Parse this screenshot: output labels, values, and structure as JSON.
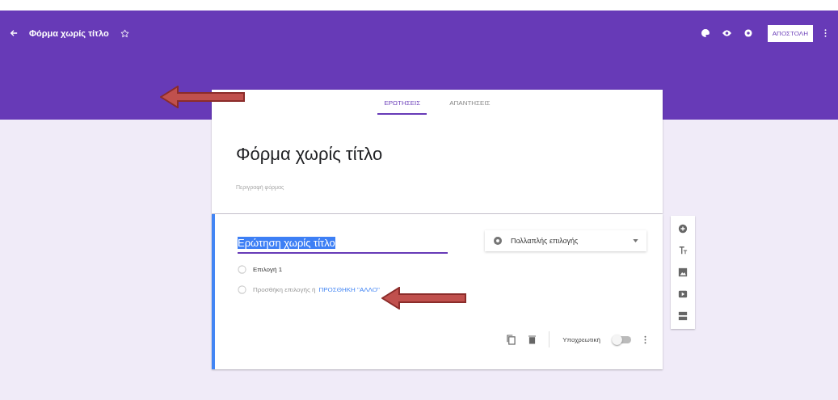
{
  "header": {
    "title": "Φόρμα χωρίς τίτλο",
    "send_label": "ΑΠΟΣΤΟΛΗ"
  },
  "tabs": [
    {
      "label": "ΕΡΩΤΗΣΕΙΣ",
      "selected": true
    },
    {
      "label": "ΑΠΑΝΤΗΣΕΙΣ",
      "selected": false
    }
  ],
  "form": {
    "title": "Φόρμα χωρίς τίτλο",
    "description_placeholder": "Περιγραφή φόρμας"
  },
  "question": {
    "title": "Ερώτηση χωρίς τίτλο",
    "title_highlighted": true,
    "type": "Πολλαπλής επιλογής",
    "options": [
      {
        "kind": "option",
        "label": "Επιλογή 1"
      },
      {
        "kind": "add",
        "label": "Προσθήκη επιλογής ή",
        "link": "ΠΡΟΣΘΗΚΗ \"ΑΛΛΟ\""
      }
    ],
    "required_label": "Υποχρεωτική",
    "required": false
  },
  "side_tools": [
    {
      "kind": "add"
    },
    {
      "kind": "title"
    },
    {
      "kind": "image"
    },
    {
      "kind": "video"
    },
    {
      "kind": "section"
    }
  ],
  "annotations": [
    {
      "kind": "arrow"
    },
    {
      "kind": "arrow"
    }
  ]
}
